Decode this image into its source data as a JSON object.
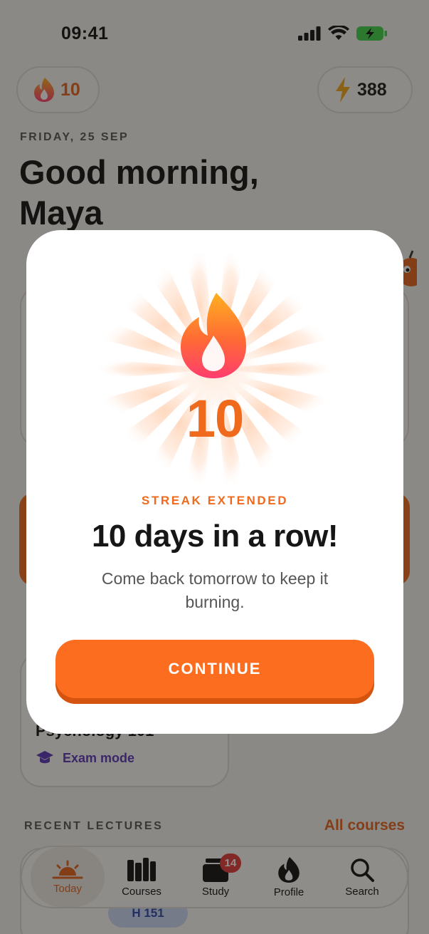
{
  "status_bar": {
    "time": "09:41"
  },
  "header": {
    "streak_count": "10",
    "energy_count": "388"
  },
  "home": {
    "date": "FRIDAY, 25 SEP",
    "greeting": "Good morning, Maya",
    "course_card": {
      "title": "Psychology 101",
      "exam_mode_label": "Exam mode"
    },
    "recent_lectures_label": "RECENT LECTURES",
    "all_courses_label": "All courses",
    "lecture_tag": "H 151"
  },
  "tabs": [
    {
      "label": "Today",
      "icon": "sunrise-icon",
      "active": true
    },
    {
      "label": "Courses",
      "icon": "books-icon",
      "active": false
    },
    {
      "label": "Study",
      "icon": "cards-icon",
      "active": false,
      "badge": "14"
    },
    {
      "label": "Profile",
      "icon": "flame-icon",
      "active": false
    },
    {
      "label": "Search",
      "icon": "search-icon",
      "active": false
    }
  ],
  "modal": {
    "streak_number": "10",
    "eyebrow": "STREAK EXTENDED",
    "headline": "10 days in a row!",
    "subtext": "Come back tomorrow to keep it burning.",
    "continue_label": "CONTINUE"
  },
  "colors": {
    "accent_orange": "#fd6d20",
    "flame_gradient_top": "#ffb020",
    "flame_gradient_bottom": "#ff3d6e",
    "badge_red": "#e23b3b",
    "exam_purple": "#5b35b8"
  }
}
